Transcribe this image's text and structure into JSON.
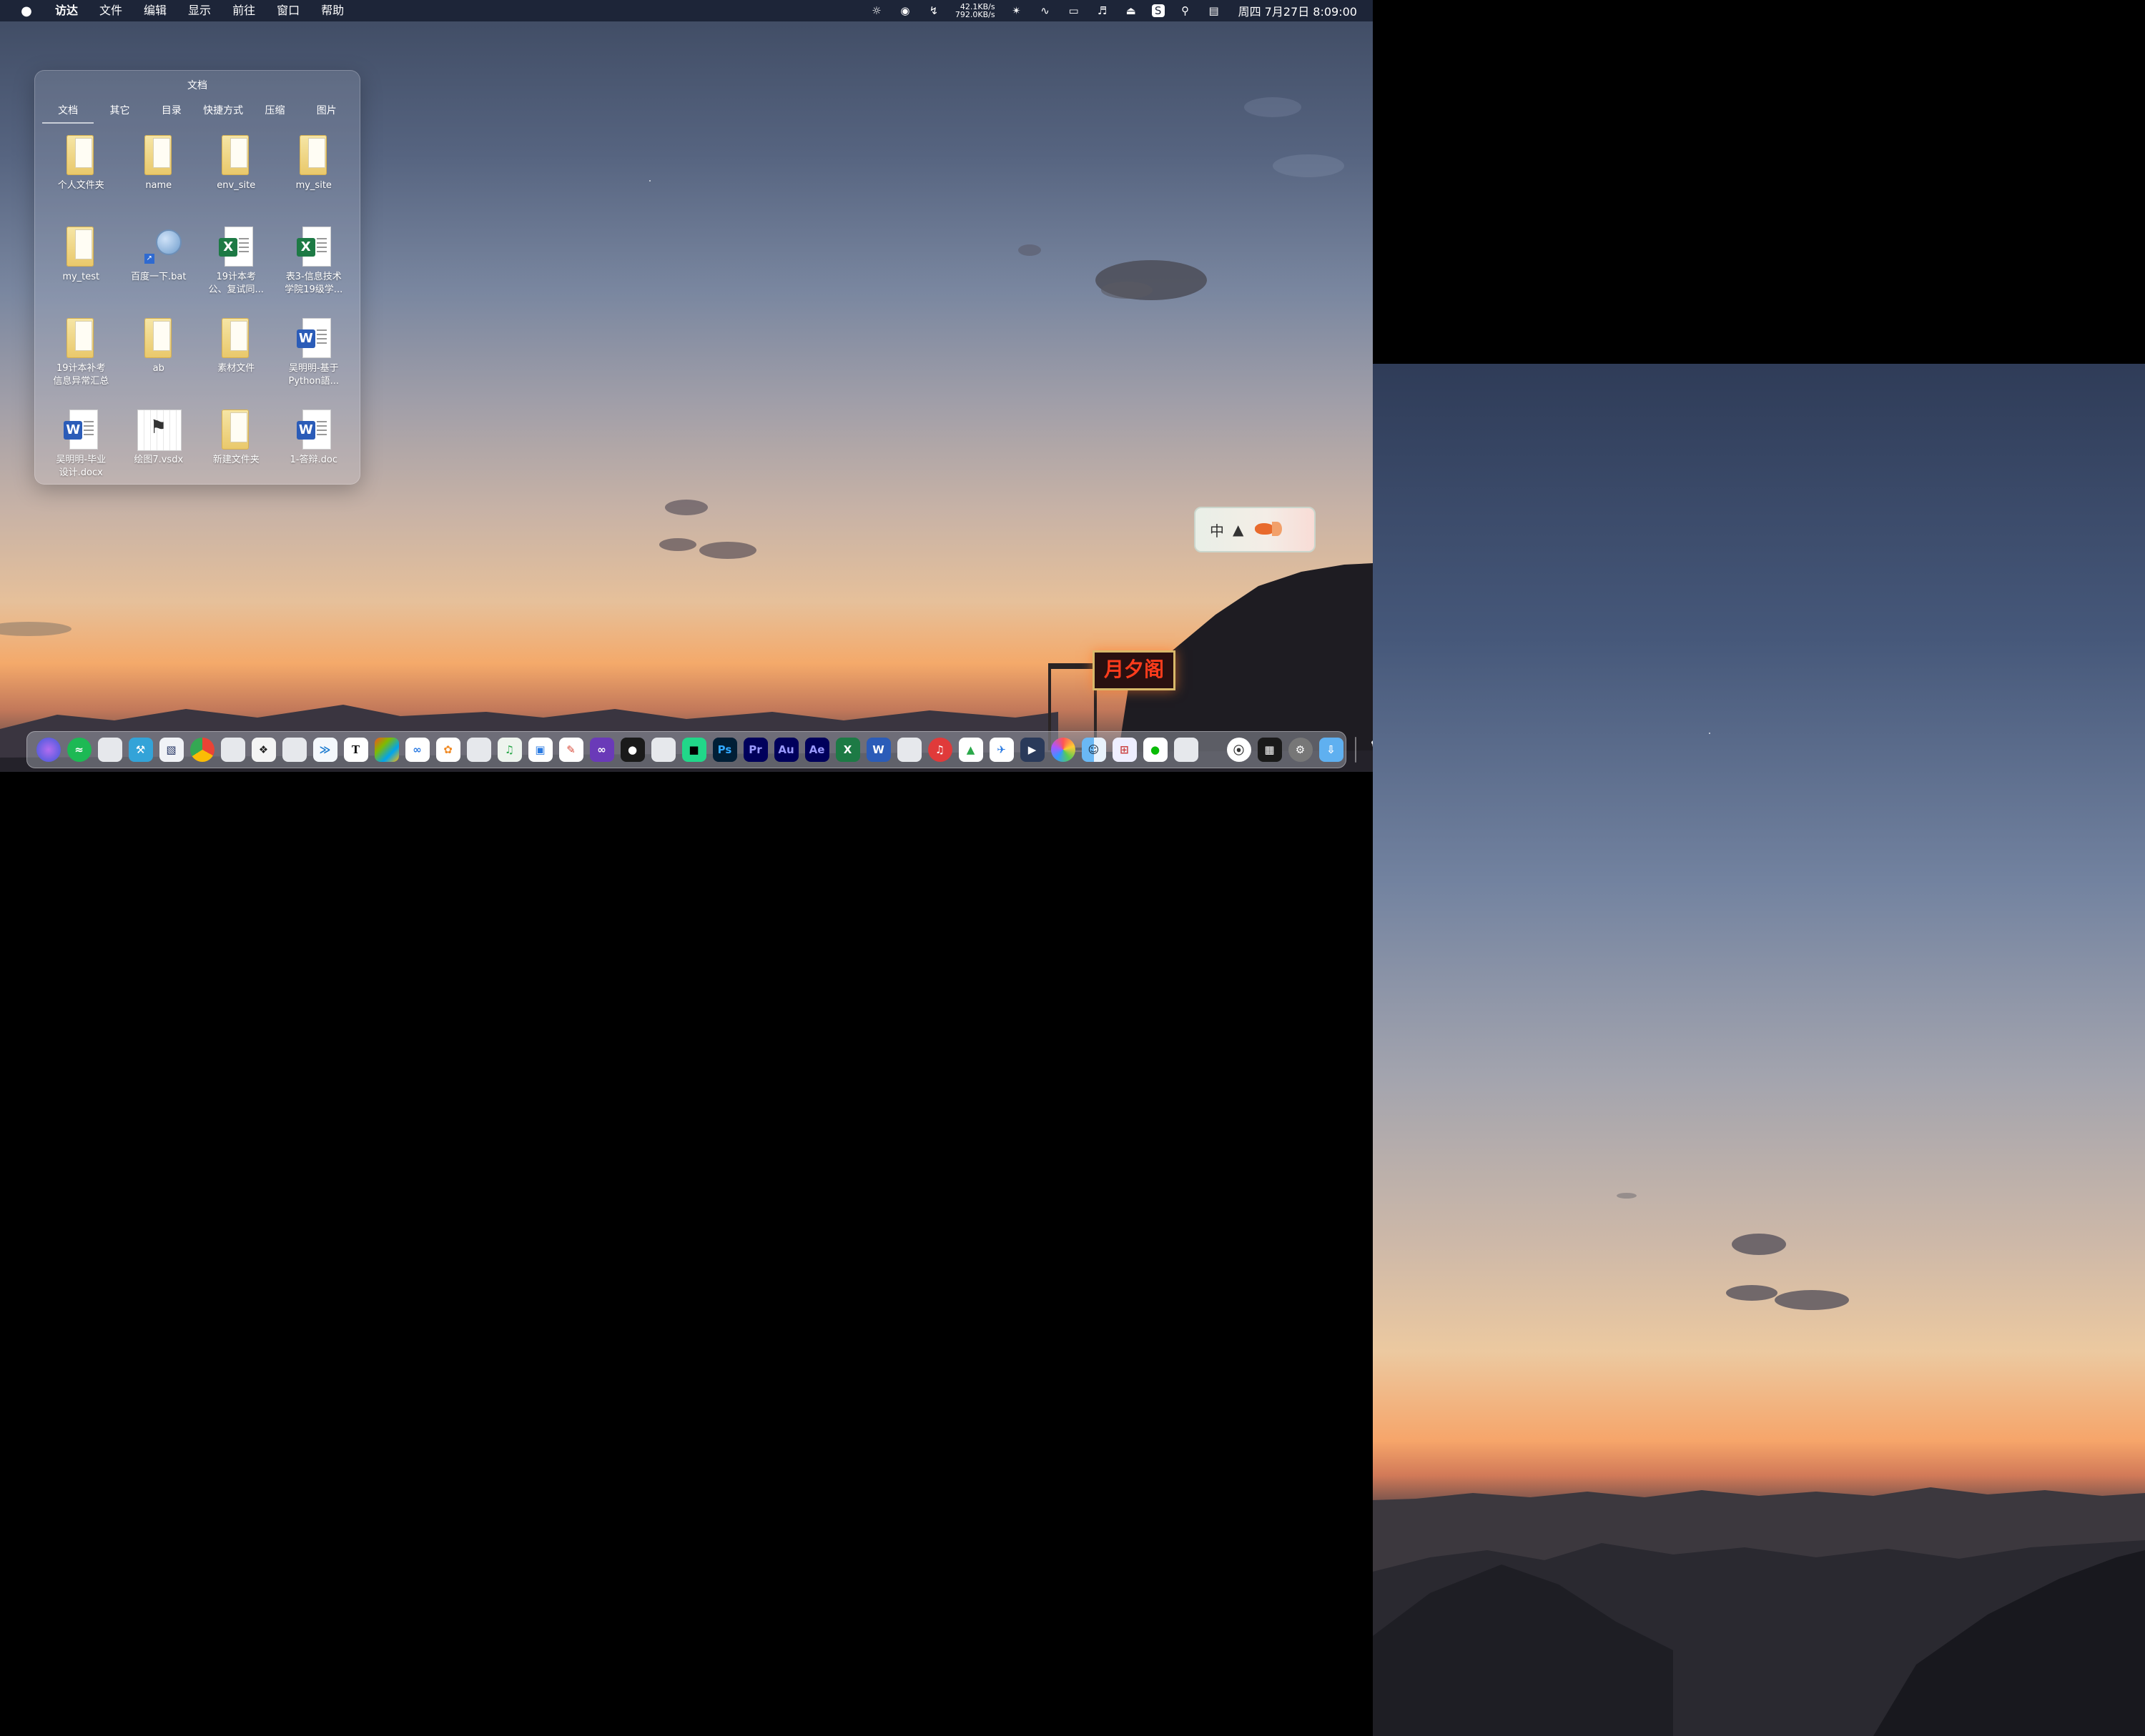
{
  "menubar": {
    "app_name": "访达",
    "menus": [
      "文件",
      "编辑",
      "显示",
      "前往",
      "窗口",
      "帮助"
    ],
    "net_up": "42.1KB/s",
    "net_down": "792.0KB/s",
    "clock": "周四 7月27日 8:09:00"
  },
  "stack": {
    "title": "文档",
    "tabs": [
      "文档",
      "其它",
      "目录",
      "快捷方式",
      "压缩",
      "图片"
    ],
    "items": [
      {
        "label": "个人文件夹",
        "type": "folder"
      },
      {
        "label": "name",
        "type": "folder"
      },
      {
        "label": "env_site",
        "type": "folder"
      },
      {
        "label": "my_site",
        "type": "folder"
      },
      {
        "label": "my_test",
        "type": "folder"
      },
      {
        "label": "百度一下.bat",
        "type": "search"
      },
      {
        "label": "19计本考\n公、复试同...",
        "type": "excel"
      },
      {
        "label": "表3-信息技术\n学院19级学...",
        "type": "excel"
      },
      {
        "label": "19计本补考\n信息异常汇总",
        "type": "folder"
      },
      {
        "label": "ab",
        "type": "folder"
      },
      {
        "label": "素材文件",
        "type": "folder"
      },
      {
        "label": "吴明明-基于\nPython語...",
        "type": "word"
      },
      {
        "label": "吴明明-毕业\n设计.docx",
        "type": "word"
      },
      {
        "label": "绘图7.vsdx",
        "type": "visio"
      },
      {
        "label": "新建文件夹",
        "type": "folder"
      },
      {
        "label": "1-答辩.doc",
        "type": "word"
      }
    ]
  },
  "ime": {
    "mode": "中"
  },
  "sign_text": "月夕阁",
  "dock": {
    "ps_label": "Ps",
    "pr_label": "Pr",
    "au_label": "Au",
    "ae_label": "Ae",
    "typora_label": "T",
    "excel_label": "X",
    "word_label": "W"
  }
}
